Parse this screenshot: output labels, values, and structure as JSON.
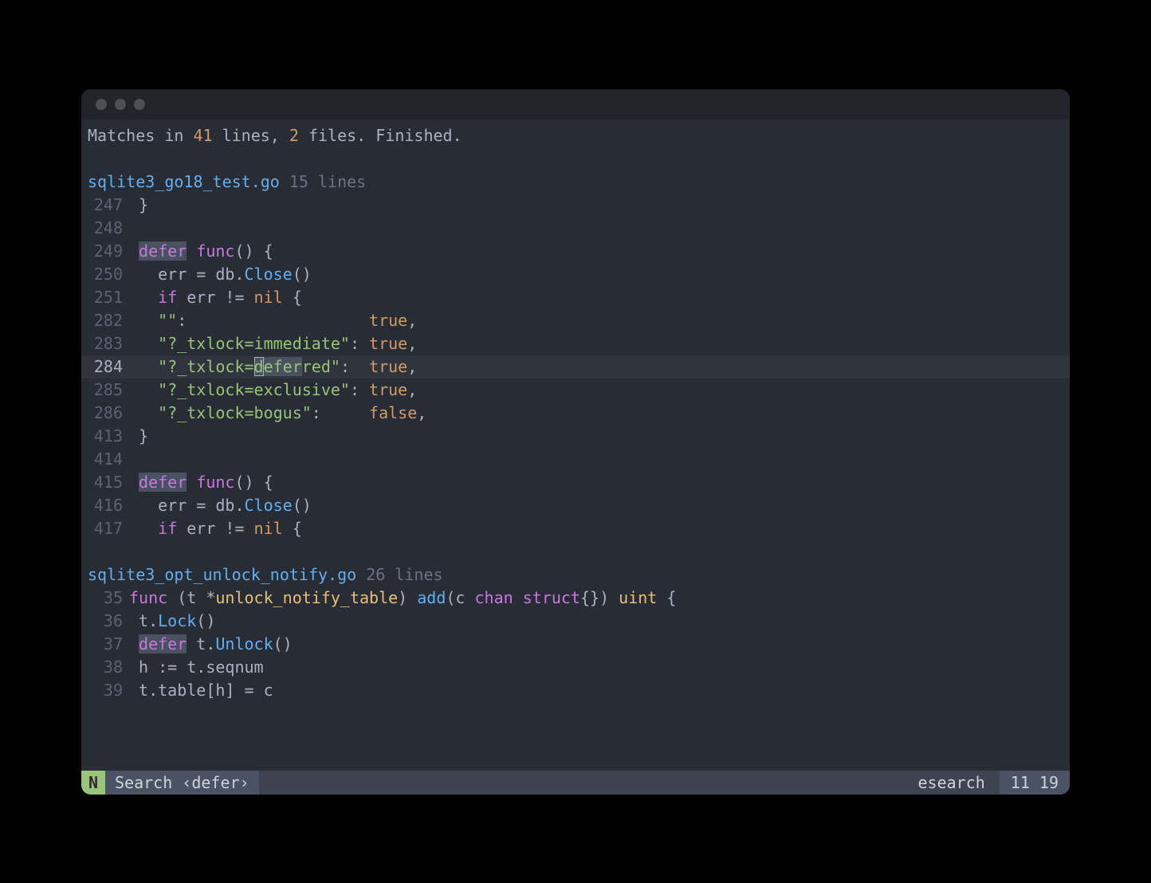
{
  "summary": {
    "prefix": "Matches in ",
    "lines": "41",
    "mid1": " lines, ",
    "files": "2",
    "mid2": " files. ",
    "end": "Finished."
  },
  "file1": {
    "name": "sqlite3_go18_test.go",
    "count": "15 lines"
  },
  "f1_rows": {
    "r247": {
      "n": "247",
      "t1": " }"
    },
    "r248": {
      "n": "248",
      "t1": ""
    },
    "r249": {
      "n": "249",
      "hl": "defer",
      "t2": " ",
      "kw": "func",
      "t3": "() {"
    },
    "r250": {
      "n": "250",
      "t1": "   err = db.",
      "fn": "Close",
      "t2": "()"
    },
    "r251": {
      "n": "251",
      "t1": "   ",
      "kw": "if",
      "t2": " err != ",
      "cn": "nil",
      "t3": " {"
    },
    "r282": {
      "n": "282",
      "t1": "   ",
      "s": "\"\"",
      "t2": ":                   ",
      "cn": "true",
      "t3": ","
    },
    "r283": {
      "n": "283",
      "t1": "   ",
      "s": "\"?_txlock=immediate\"",
      "t2": ": ",
      "cn": "true",
      "t3": ","
    },
    "r284": {
      "n": "284",
      "t1": "   ",
      "sa": "\"?_txlock=",
      "cur": "d",
      "hl": "efer",
      "sb": "red\"",
      "t2": ":  ",
      "cn": "true",
      "t3": ","
    },
    "r285": {
      "n": "285",
      "t1": "   ",
      "s": "\"?_txlock=exclusive\"",
      "t2": ": ",
      "cn": "true",
      "t3": ","
    },
    "r286": {
      "n": "286",
      "t1": "   ",
      "s": "\"?_txlock=bogus\"",
      "t2": ":     ",
      "cn": "false",
      "t3": ","
    },
    "r413": {
      "n": "413",
      "t1": " }"
    },
    "r414": {
      "n": "414",
      "t1": ""
    },
    "r415": {
      "n": "415",
      "hl": "defer",
      "t2": " ",
      "kw": "func",
      "t3": "() {"
    },
    "r416": {
      "n": "416",
      "t1": "   err = db.",
      "fn": "Close",
      "t2": "()"
    },
    "r417": {
      "n": "417",
      "t1": "   ",
      "kw": "if",
      "t2": " err != ",
      "cn": "nil",
      "t3": " {"
    }
  },
  "file2": {
    "name": "sqlite3_opt_unlock_notify.go",
    "count": "26 lines"
  },
  "f2_rows": {
    "r35": {
      "n": "35",
      "kw1": "func",
      "t1": " (t *",
      "ty": "unlock_notify_table",
      "t2": ") ",
      "fn": "add",
      "t3": "(c ",
      "kw2": "chan",
      "t4": " ",
      "kw3": "struct",
      "t5": "{}) ",
      "ty2": "uint",
      "t6": " {"
    },
    "r36": {
      "n": "36",
      "t1": " t.",
      "fn": "Lock",
      "t2": "()"
    },
    "r37": {
      "n": "37",
      "t1": " ",
      "hl": "defer",
      "t2": " t.",
      "fn": "Unlock",
      "t3": "()"
    },
    "r38": {
      "n": "38",
      "t1": " h := t.seqnum"
    },
    "r39": {
      "n": "39",
      "t1": " t.table[h] = c"
    }
  },
  "status": {
    "mode": "N",
    "title": "Search ‹defer›",
    "mid": "esearch",
    "pos": "11 19"
  }
}
